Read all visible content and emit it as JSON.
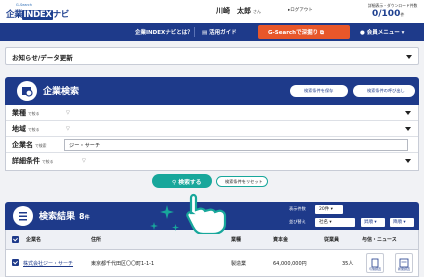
{
  "header": {
    "logo_small": "G-Search",
    "logo_prefix": "企業",
    "logo_index": "INDEX",
    "logo_suffix": "ナビ",
    "user_name": "川崎　太郎",
    "user_suffix": "さん",
    "logout_label": "ログアウト",
    "download_label": "詳細表示・ダウンロード件数",
    "download_count": "0/100",
    "download_unit": "件"
  },
  "nav": {
    "about": "企業INDEXナビとは？",
    "guide": "活用ガイド",
    "gsearch": "G-Searchで深掘り",
    "member_menu": "会員メニュー"
  },
  "news": {
    "label": "お知らせ/データ更新"
  },
  "search": {
    "title": "企業検索",
    "save_conditions": "検索条件を保存",
    "load_conditions": "検索条件の呼び出し",
    "rows": {
      "industry": {
        "label": "業種",
        "sub": "で絞る"
      },
      "region": {
        "label": "地域",
        "sub": "で絞る"
      },
      "company_name": {
        "label": "企業名",
        "sub": "で検索",
        "value": "ジー・サーチ"
      },
      "detail": {
        "label": "詳細条件",
        "sub": "で絞る"
      }
    },
    "search_button": "検索する",
    "reset_button": "検索条件をリセット"
  },
  "results": {
    "title": "検索結果",
    "count": "8",
    "count_unit": "件",
    "display_count_label": "表示件数",
    "display_count_value": "20件",
    "sort_label": "並び替え",
    "sort_value": "社名",
    "asc_button": "昇順",
    "desc_button": "降順",
    "columns": {
      "company": "企業名",
      "address": "住所",
      "industry": "業種",
      "capital": "資本金",
      "employees": "従業員",
      "credit_news": "与信・ニュース"
    },
    "rows": [
      {
        "company": "株式会社ジー・サーチ",
        "address": "東京都千代田区〇〇町1-1-1",
        "industry": "製造業",
        "capital": "64,000,000円",
        "employees": "35人",
        "credit_btn": "与信調査",
        "news_btn": "新聞調査"
      }
    ]
  },
  "colors": {
    "navy": "#1e3a8a",
    "teal": "#18a79b",
    "orange": "#e8572a"
  }
}
